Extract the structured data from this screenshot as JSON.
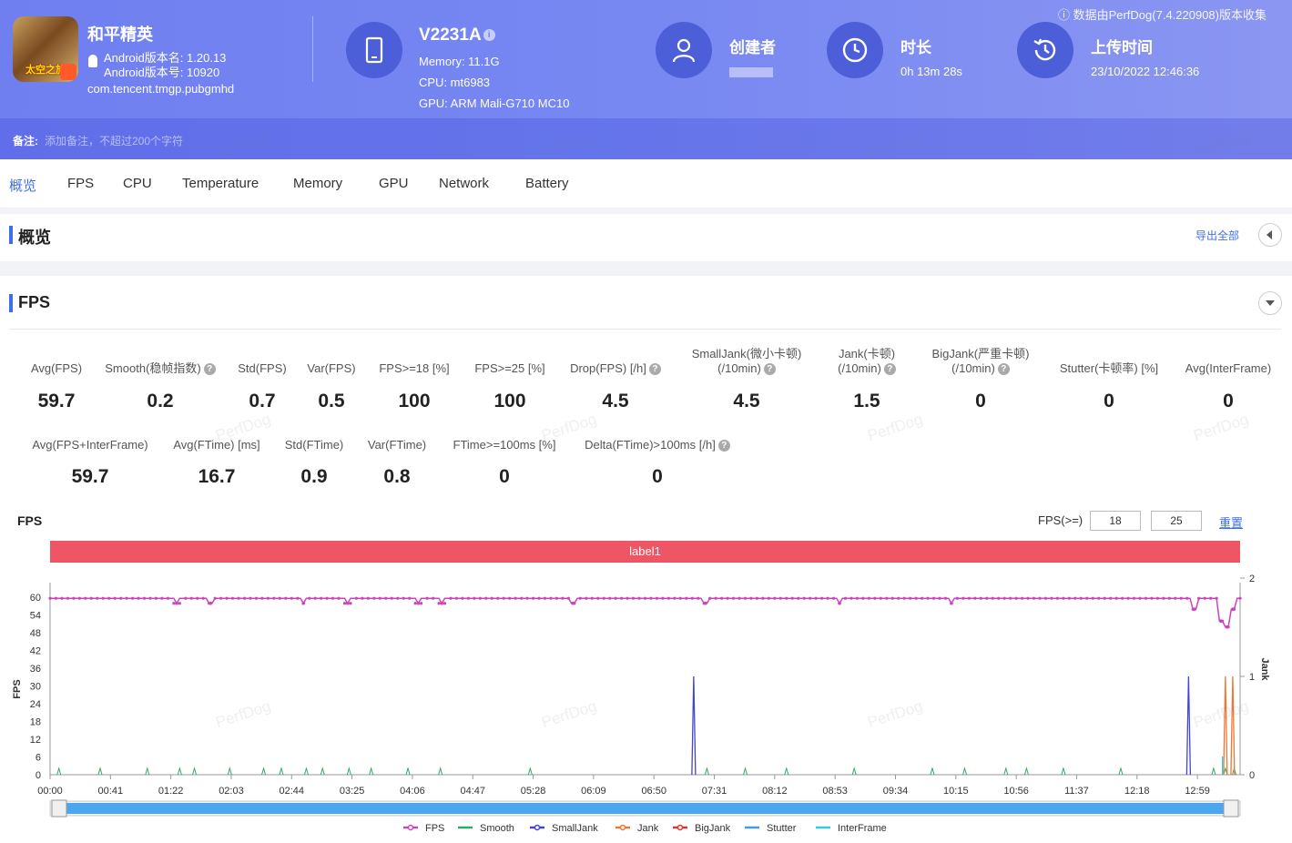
{
  "header": {
    "app_name": "和平精英",
    "app_icon_text": "太空之旅",
    "version_name": "Android版本名: 1.20.13",
    "version_code": "Android版本号: 10920",
    "package": "com.tencent.tmgp.pubgmhd",
    "device_name": "V2231A",
    "memory": "Memory: 11.1G",
    "cpu": "CPU: mt6983",
    "gpu": "GPU: ARM Mali-G710 MC10",
    "creator_label": "创建者",
    "duration_label": "时长",
    "duration_value": "0h 13m 28s",
    "upload_label": "上传时间",
    "upload_value": "23/10/2022 12:46:36",
    "collected_by": "ⓘ 数据由PerfDog(7.4.220908)版本收集",
    "note_label": "备注:",
    "note_placeholder": "添加备注，不超过200个字符"
  },
  "tabs": [
    "概览",
    "FPS",
    "CPU",
    "Temperature",
    "Memory",
    "GPU",
    "Network",
    "Battery"
  ],
  "overview": {
    "title": "概览",
    "export": "导出全部"
  },
  "fps_section": {
    "title": "FPS"
  },
  "stats_row1": [
    {
      "label": "Avg(FPS)",
      "value": "59.7"
    },
    {
      "label": "Smooth(稳帧指数)",
      "value": "0.2",
      "help": true
    },
    {
      "label": "Std(FPS)",
      "value": "0.7"
    },
    {
      "label": "Var(FPS)",
      "value": "0.5"
    },
    {
      "label": "FPS>=18 [%]",
      "value": "100"
    },
    {
      "label": "FPS>=25 [%]",
      "value": "100"
    },
    {
      "label": "Drop(FPS) [/h]",
      "value": "4.5",
      "help": true
    },
    {
      "label": "SmallJank(微小卡顿)",
      "label2": "(/10min)",
      "value": "4.5",
      "help": true
    },
    {
      "label": "Jank(卡顿)",
      "label2": "(/10min)",
      "value": "1.5",
      "help": true
    },
    {
      "label": "BigJank(严重卡顿)",
      "label2": "(/10min)",
      "value": "0",
      "help": true
    },
    {
      "label": "Stutter(卡顿率) [%]",
      "value": "0"
    },
    {
      "label": "Avg(InterFrame)",
      "value": "0"
    }
  ],
  "stats_row2": [
    {
      "label": "Avg(FPS+InterFrame)",
      "value": "59.7"
    },
    {
      "label": "Avg(FTime) [ms]",
      "value": "16.7"
    },
    {
      "label": "Std(FTime)",
      "value": "0.9"
    },
    {
      "label": "Var(FTime)",
      "value": "0.8"
    },
    {
      "label": "FTime>=100ms [%]",
      "value": "0"
    },
    {
      "label": "Delta(FTime)>100ms [/h]",
      "value": "0",
      "help": true
    }
  ],
  "chart_controls": {
    "title": "FPS",
    "threshold_label": "FPS(>=)",
    "threshold1": "18",
    "threshold2": "25",
    "reset": "重置",
    "label_bar": "label1"
  },
  "chart_data": {
    "type": "line",
    "ylabel": "FPS",
    "y2label": "Jank",
    "yticks": [
      "60",
      "54",
      "48",
      "42",
      "36",
      "30",
      "24",
      "18",
      "12",
      "6",
      "0"
    ],
    "y2ticks": [
      "2",
      "1",
      "0"
    ],
    "ylim": [
      0,
      65
    ],
    "y2lim": [
      0,
      2
    ],
    "xticks": [
      "00:00",
      "00:41",
      "01:22",
      "02:03",
      "02:44",
      "03:25",
      "04:06",
      "04:47",
      "05:28",
      "06:09",
      "06:50",
      "07:31",
      "08:12",
      "08:53",
      "09:34",
      "10:15",
      "10:56",
      "11:37",
      "12:18",
      "12:59"
    ],
    "x_range_seconds": [
      0,
      808
    ],
    "fps_baseline": 59.7,
    "fps_dips": [
      {
        "t": 86,
        "fps": 58
      },
      {
        "t": 109,
        "fps": 58
      },
      {
        "t": 172,
        "fps": 58
      },
      {
        "t": 202,
        "fps": 58
      },
      {
        "t": 250,
        "fps": 58
      },
      {
        "t": 266,
        "fps": 58
      },
      {
        "t": 355,
        "fps": 58
      },
      {
        "t": 445,
        "fps": 58
      },
      {
        "t": 536,
        "fps": 58
      },
      {
        "t": 612,
        "fps": 58
      },
      {
        "t": 777,
        "fps": 56
      },
      {
        "t": 795,
        "fps": 52
      },
      {
        "t": 799,
        "fps": 50
      },
      {
        "t": 803,
        "fps": 56
      }
    ],
    "smooth_spikes": [
      6,
      34,
      66,
      88,
      98,
      122,
      145,
      157,
      174,
      185,
      203,
      218,
      243,
      265,
      326,
      446,
      472,
      500,
      546,
      599,
      621,
      649,
      663,
      688,
      727,
      790,
      798,
      804
    ],
    "smalljank_spikes": [
      {
        "t": 437,
        "v": 1
      },
      {
        "t": 773,
        "v": 1
      }
    ],
    "jank_spikes": [
      {
        "t": 798,
        "v": 1
      },
      {
        "t": 803,
        "v": 1
      }
    ],
    "bigjank_spikes": [],
    "legend": [
      {
        "name": "FPS",
        "color": "#cc44bb"
      },
      {
        "name": "Smooth",
        "color": "#33aa66"
      },
      {
        "name": "SmallJank",
        "color": "#4444cc"
      },
      {
        "name": "Jank",
        "color": "#ee7733"
      },
      {
        "name": "BigJank",
        "color": "#dd3333"
      },
      {
        "name": "Stutter",
        "color": "#4499ee"
      },
      {
        "name": "InterFrame",
        "color": "#33ccdd"
      }
    ]
  },
  "watermark": "PerfDog"
}
